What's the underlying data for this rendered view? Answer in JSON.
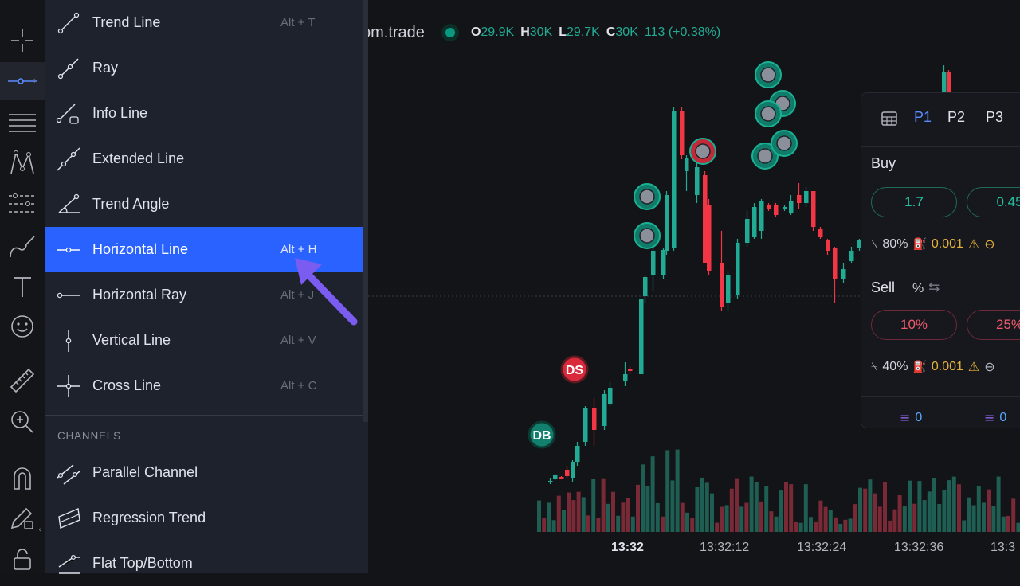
{
  "toolbar": {
    "tools": [
      {
        "name": "crosshair-icon"
      },
      {
        "name": "horizontal-line-tool-icon"
      },
      {
        "name": "fib-lines-icon"
      },
      {
        "name": "pattern-icon"
      },
      {
        "name": "prediction-icon"
      },
      {
        "name": "brush-icon"
      },
      {
        "name": "text-icon"
      },
      {
        "name": "emoji-icon"
      },
      {
        "name": "ruler-icon"
      },
      {
        "name": "zoom-in-icon"
      },
      {
        "name": "magnet-icon"
      },
      {
        "name": "pencil-lock-icon"
      },
      {
        "name": "lock-icon"
      }
    ]
  },
  "menu": {
    "items": [
      {
        "label": "Trend Line",
        "shortcut": "Alt + T"
      },
      {
        "label": "Ray",
        "shortcut": ""
      },
      {
        "label": "Info Line",
        "shortcut": ""
      },
      {
        "label": "Extended Line",
        "shortcut": ""
      },
      {
        "label": "Trend Angle",
        "shortcut": ""
      },
      {
        "label": "Horizontal Line",
        "shortcut": "Alt + H"
      },
      {
        "label": "Horizontal Ray",
        "shortcut": "Alt + J"
      },
      {
        "label": "Vertical Line",
        "shortcut": "Alt + V"
      },
      {
        "label": "Cross Line",
        "shortcut": "Alt + C"
      }
    ],
    "section_channels": "CHANNELS",
    "channel_items": [
      {
        "label": "Parallel Channel"
      },
      {
        "label": "Regression Trend"
      },
      {
        "label": "Flat Top/Bottom"
      }
    ]
  },
  "legend": {
    "symbol": "om.trade",
    "o_label": "O",
    "o_value": "29.9K",
    "h_label": "H",
    "h_value": "30K",
    "l_label": "L",
    "l_value": "29.7K",
    "c_label": "C",
    "c_value": "30K",
    "change": "113 (+0.38%)"
  },
  "time_axis": [
    "13:32",
    "13:32:12",
    "13:32:24",
    "13:32:36",
    "13:3"
  ],
  "markers": {
    "ds": "DS",
    "db": "DB"
  },
  "panel": {
    "tabs": [
      "P1",
      "P2",
      "P3"
    ],
    "buy_title": "Buy",
    "buy_amounts": [
      "1.7",
      "0.45"
    ],
    "buy_pct": "80%",
    "buy_qty": "0.001",
    "sell_title": "Sell",
    "sell_pct_symbol": "%",
    "sell_amounts": [
      "10%",
      "25%"
    ],
    "sell_pct": "40%",
    "sell_qty": "0.001",
    "foot_left": "0",
    "foot_right": "0"
  },
  "colors": {
    "accent": "#2962ff",
    "up": "#22ab94",
    "down": "#f23645",
    "arrow": "#7b5cf0"
  }
}
